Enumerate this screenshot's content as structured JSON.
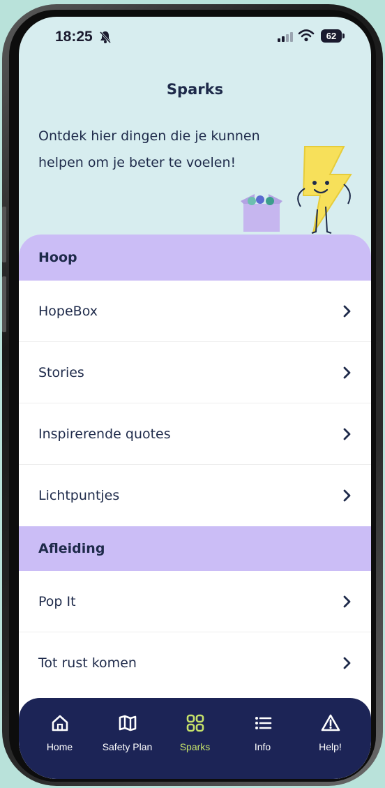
{
  "status_bar": {
    "time": "18:25",
    "battery": "62"
  },
  "header": {
    "title": "Sparks",
    "intro": "Ontdek hier dingen die je kunnen helpen om je beter te voelen!"
  },
  "sections": [
    {
      "title": "Hoop",
      "items": [
        "HopeBox",
        "Stories",
        "Inspirerende quotes",
        "Lichtpuntjes"
      ]
    },
    {
      "title": "Afleiding",
      "items": [
        "Pop It",
        "Tot rust komen"
      ]
    }
  ],
  "nav": {
    "items": [
      {
        "label": "Home",
        "icon": "home-icon"
      },
      {
        "label": "Safety Plan",
        "icon": "map-icon"
      },
      {
        "label": "Sparks",
        "icon": "grid-icon"
      },
      {
        "label": "Info",
        "icon": "list-icon"
      },
      {
        "label": "Help!",
        "icon": "warning-icon"
      }
    ],
    "active": "Sparks"
  },
  "colors": {
    "header_bg": "#d7edef",
    "section_bg": "#cbbdf6",
    "nav_bg": "#1c2456",
    "nav_active": "#c6e26a",
    "text": "#1e2a4a"
  }
}
